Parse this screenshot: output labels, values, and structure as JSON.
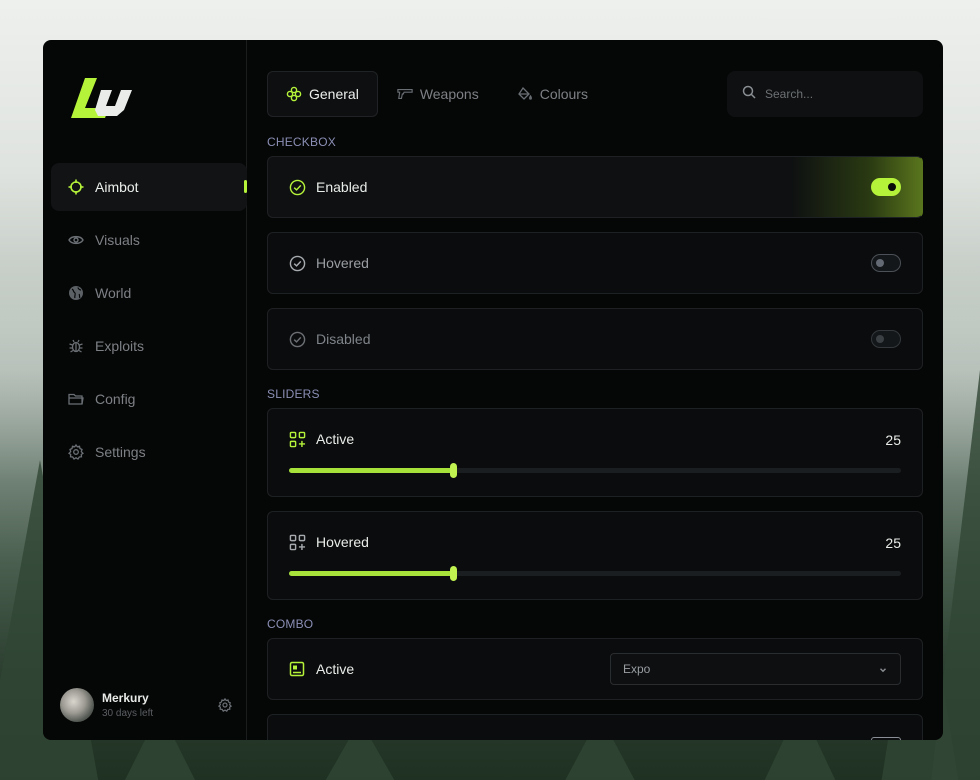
{
  "brand": {
    "accent": "#b5f23a"
  },
  "sidebar": {
    "items": [
      {
        "label": "Aimbot",
        "icon": "crosshair-icon",
        "active": true
      },
      {
        "label": "Visuals",
        "icon": "eye-icon"
      },
      {
        "label": "World",
        "icon": "globe-icon"
      },
      {
        "label": "Exploits",
        "icon": "bug-icon"
      },
      {
        "label": "Config",
        "icon": "folder-icon"
      },
      {
        "label": "Settings",
        "icon": "gear-icon"
      }
    ],
    "user": {
      "name": "Merkury",
      "subtitle": "30 days left"
    }
  },
  "header": {
    "tabs": [
      {
        "label": "General",
        "icon": "flower-icon",
        "active": true
      },
      {
        "label": "Weapons",
        "icon": "pistol-icon"
      },
      {
        "label": "Colours",
        "icon": "paint-bucket-icon"
      }
    ],
    "search": {
      "placeholder": "Search..."
    }
  },
  "sections": {
    "checkbox": {
      "title": "CHECKBOX",
      "rows": [
        {
          "label": "Enabled",
          "state": "on"
        },
        {
          "label": "Hovered",
          "state": "hover"
        },
        {
          "label": "Disabled",
          "state": "off"
        }
      ]
    },
    "sliders": {
      "title": "SLIDERS",
      "rows": [
        {
          "label": "Active",
          "value": "25",
          "fraction": 0.268
        },
        {
          "label": "Hovered",
          "value": "25",
          "fraction": 0.268
        }
      ]
    },
    "combo": {
      "title": "COMBO",
      "rows": [
        {
          "label": "Active",
          "value": "Expo"
        }
      ]
    }
  }
}
